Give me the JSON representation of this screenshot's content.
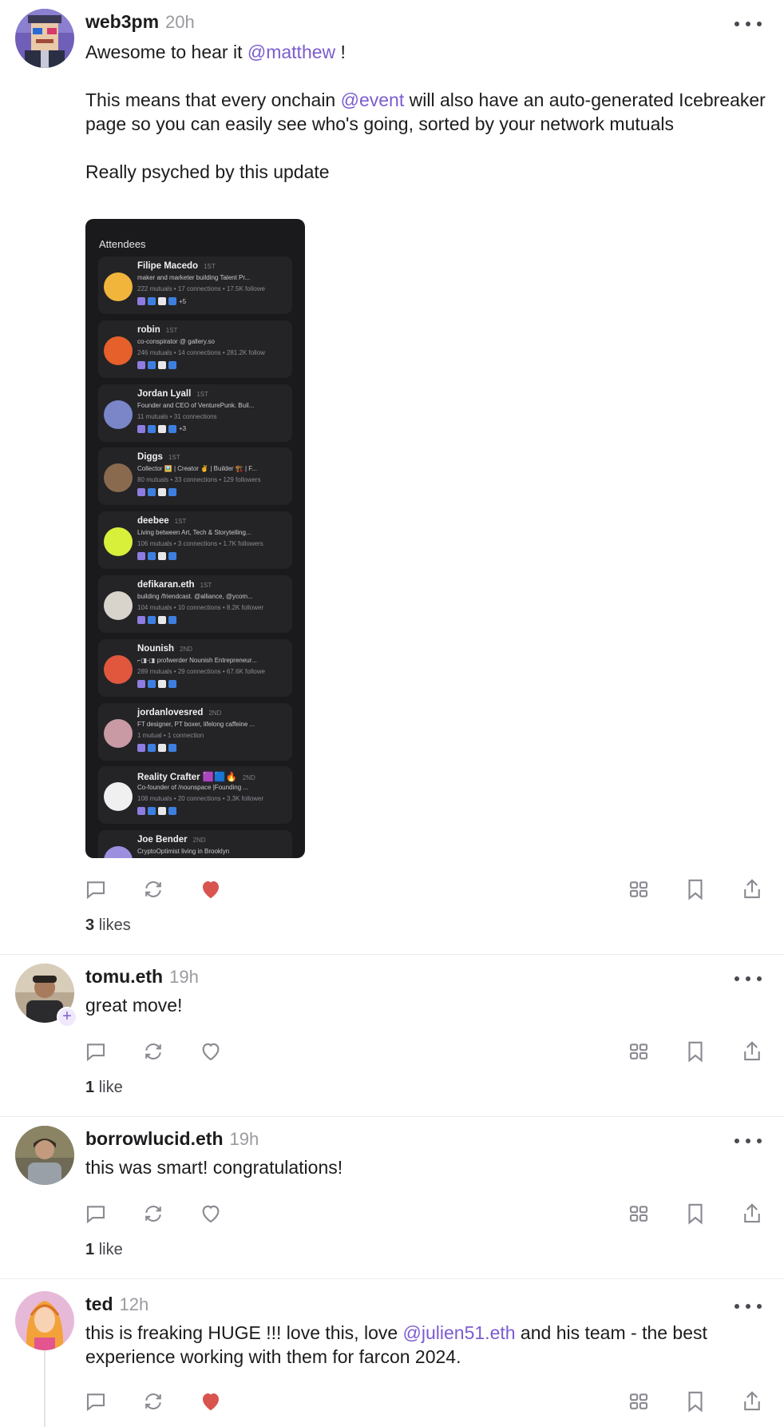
{
  "posts": [
    {
      "username": "web3pm",
      "time": "20h",
      "paragraphs": [
        {
          "before": "Awesome to hear it ",
          "mention": "@matthew",
          "after": " !"
        },
        {
          "before": "This means that every onchain ",
          "mention": "@event",
          "after": " will also have an auto-generated Icebreaker page so you can easily see who's going, sorted by your network mutuals"
        },
        {
          "before": "Really psyched by this update",
          "mention": "",
          "after": ""
        }
      ],
      "liked": true,
      "likes_count": "3",
      "likes_word": "likes"
    },
    {
      "username": "tomu.eth",
      "time": "19h",
      "text": "great move!",
      "liked": false,
      "likes_count": "1",
      "likes_word": "like",
      "follow_badge": "+"
    },
    {
      "username": "borrowlucid.eth",
      "time": "19h",
      "text": "this was smart! congratulations!",
      "liked": false,
      "likes_count": "1",
      "likes_word": "like"
    },
    {
      "username": "ted",
      "time": "12h",
      "text_before": "this is freaking HUGE !!! love this, love ",
      "mention": "@julien51.eth",
      "text_after": " and his team - the best experience working with them for farcon 2024.",
      "liked": true
    }
  ],
  "embed": {
    "title": "Attendees",
    "attendees": [
      {
        "name": "Filipe Macedo",
        "degree": "1ST",
        "bio": "maker and marketer building Talent Pr...",
        "stats": "222 mutuals • 17 connections • 17.5K followe",
        "more": "+5",
        "color": "#f2b53c"
      },
      {
        "name": "robin",
        "degree": "1ST",
        "bio": "co-conspirator @ gallery.so",
        "stats": "246 mutuals • 14 connections • 281.2K follow",
        "more": "",
        "color": "#e5602a"
      },
      {
        "name": "Jordan Lyall",
        "degree": "1ST",
        "bio": "Founder and CEO of VenturePunk. Buil...",
        "stats": "11 mutuals • 31 connections",
        "more": "+3",
        "color": "#7b86c9"
      },
      {
        "name": "Diggs",
        "degree": "1ST",
        "bio": "Collector 🖼️ | Creator ✌️ | Builder 🏗️ | F...",
        "stats": "80 mutuals • 33 connections • 129 followers",
        "more": "",
        "color": "#8a6a4e"
      },
      {
        "name": "deebee",
        "degree": "1ST",
        "bio": "Living between Art, Tech & Storytelling...",
        "stats": "106 mutuals • 3 connections • 1.7K followers",
        "more": "",
        "color": "#d8f03a"
      },
      {
        "name": "defikaran.eth",
        "degree": "1ST",
        "bio": "building /friendcast. @alliance, @ycom...",
        "stats": "104 mutuals • 10 connections • 8.2K follower",
        "more": "",
        "color": "#d8d4cc"
      },
      {
        "name": "Nounish",
        "degree": "2ND",
        "bio": "⌐◨-◨ profwerder Nounish Entrepreneur...",
        "stats": "289 mutuals • 29 connections • 67.6K followe",
        "more": "",
        "color": "#e0573e"
      },
      {
        "name": "jordanlovesred",
        "degree": "2ND",
        "bio": "FT designer, PT boxer, lifelong caffeine ...",
        "stats": "1 mutual • 1 connection",
        "more": "",
        "color": "#c99aa4"
      },
      {
        "name": "Reality Crafter 🟪🟦🔥",
        "degree": "2ND",
        "bio": "Co-founder of /nounspace |Founding ...",
        "stats": "108 mutuals • 20 connections • 3.3K follower",
        "more": "",
        "color": "#f0f0f0"
      },
      {
        "name": "Joe Bender",
        "degree": "2ND",
        "bio": "CryptoOptimist living in Brooklyn",
        "stats": "",
        "more": "",
        "color": "#9c8fe0"
      }
    ]
  },
  "colors": {
    "accent": "#7c5cd0",
    "like_red": "#d9534f",
    "icon_gray": "#8a8a92"
  }
}
